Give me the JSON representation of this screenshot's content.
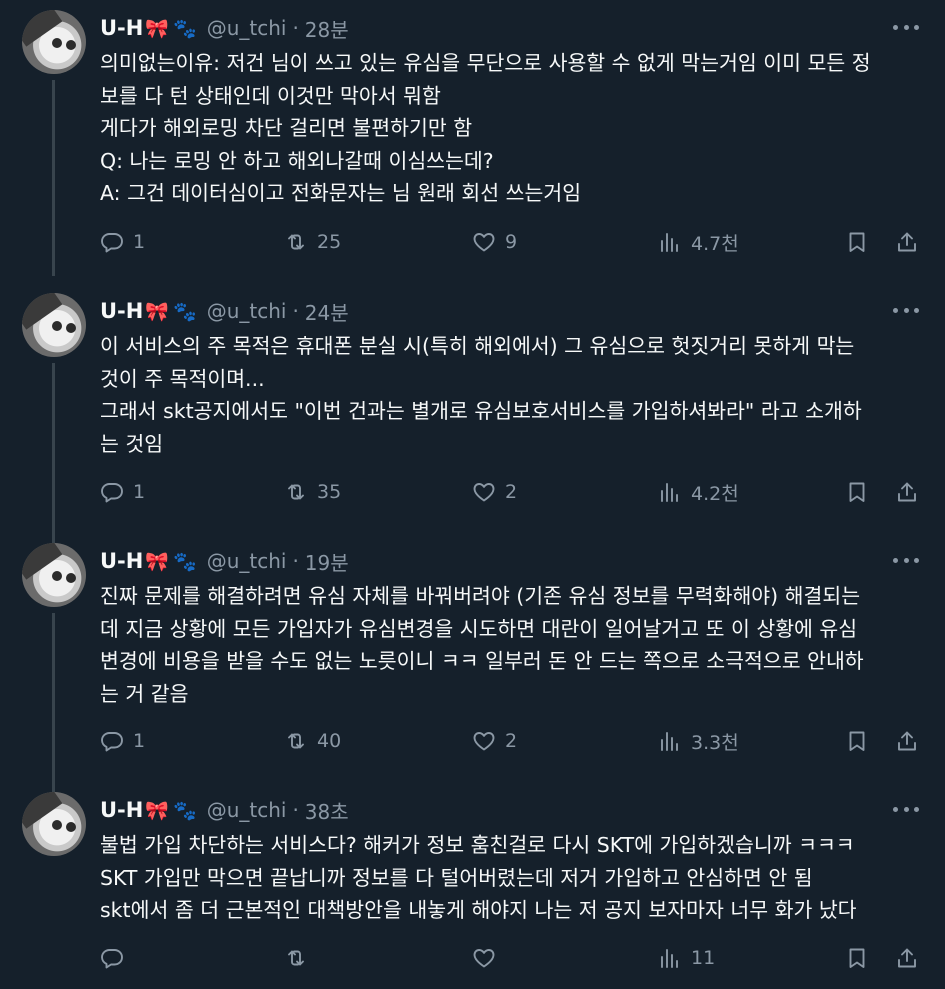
{
  "tweets": [
    {
      "name": "U-H",
      "handle": "@u_tchi",
      "dot": "·",
      "time": "28분",
      "lines": [
        "의미없는이유: 저건 님이 쓰고 있는 유심을 무단으로 사용할 수 없게 막는거임 이미 모든 정",
        "보를 다 턴 상태인데 이것만  막아서 뭐함",
        "게다가 해외로밍 차단 걸리면 불편하기만 함",
        "Q: 나는 로밍 안 하고 해외나갈때 이심쓰는데?",
        "A: 그건 데이터심이고 전화문자는 님 원래 회선 쓰는거임"
      ],
      "replies": "1",
      "retweets": "25",
      "likes": "9",
      "views": "4.7천"
    },
    {
      "name": "U-H",
      "handle": "@u_tchi",
      "dot": "·",
      "time": "24분",
      "lines": [
        "이 서비스의 주 목적은 휴대폰 분실 시(특히 해외에서) 그 유심으로 헛짓거리 못하게 막는",
        "것이 주 목적이며...",
        "그래서 skt공지에서도 \"이번 건과는 별개로 유심보호서비스를 가입하셔봐라\" 라고 소개하",
        "는 것임"
      ],
      "replies": "1",
      "retweets": "35",
      "likes": "2",
      "views": "4.2천"
    },
    {
      "name": "U-H",
      "handle": "@u_tchi",
      "dot": "·",
      "time": "19분",
      "lines": [
        "진짜 문제를 해결하려면 유심 자체를 바꿔버려야 (기존 유심 정보를 무력화해야)  해결되는",
        "데 지금 상황에 모든 가입자가 유심변경을 시도하면 대란이 일어날거고 또 이 상황에 유심",
        "변경에 비용을 받을 수도 없는 노릇이니 ㅋㅋ 일부러 돈 안 드는 쪽으로 소극적으로 안내하",
        "는 거 같음"
      ],
      "replies": "1",
      "retweets": "40",
      "likes": "2",
      "views": "3.3천"
    },
    {
      "name": "U-H",
      "handle": "@u_tchi",
      "dot": "·",
      "time": "38초",
      "lines": [
        "불법 가입 차단하는 서비스다? 해커가 정보 훔친걸로 다시 SKT에 가입하겠습니까 ㅋㅋㅋ",
        "SKT 가입만 막으면 끝납니까 정보를 다 털어버렸는데 저거 가입하고 안심하면 안 됨",
        "skt에서 좀 더 근본적인 대책방안을 내놓게 해야지 나는 저 공지 보자마자 너무 화가 났다"
      ],
      "replies": "",
      "retweets": "",
      "likes": "",
      "views": "11"
    }
  ],
  "colors": {
    "background": "#15202b",
    "text": "#f7f9f9",
    "muted": "#8b98a5",
    "thread_line": "#38444d"
  },
  "icons": {
    "emoji_1": "🎀",
    "emoji_2": "🐾",
    "reply": "reply-icon",
    "retweet": "retweet-icon",
    "like": "heart-icon",
    "views": "bar-chart-icon",
    "bookmark": "bookmark-icon",
    "share": "share-icon",
    "more": "more-icon"
  }
}
